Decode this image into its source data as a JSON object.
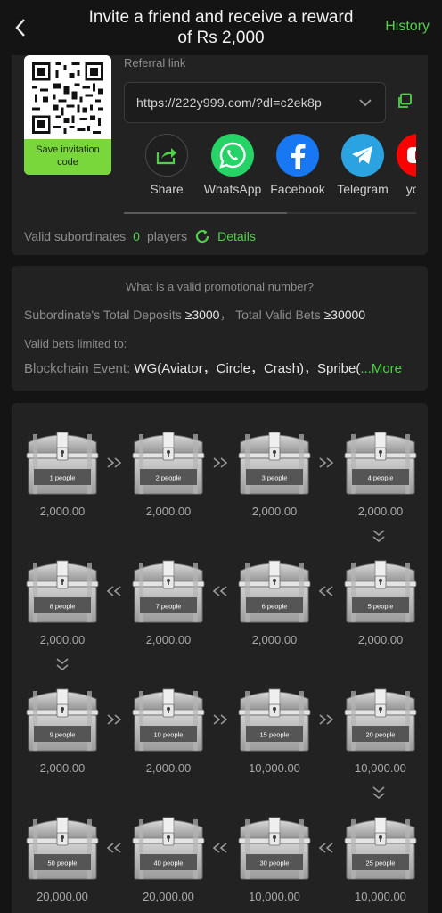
{
  "header": {
    "title": "Invite a friend and receive a reward of Rs 2,000",
    "history_label": "History"
  },
  "referral": {
    "qr_save_label": "Save invitation code",
    "link_label": "Referral link",
    "link_value": "https://222y999.com/?dl=c2ek8p"
  },
  "share": [
    {
      "label": "Share",
      "icon": "share-icon",
      "color": "#2a2a2a"
    },
    {
      "label": "WhatsApp",
      "icon": "whatsapp-icon",
      "color": "#25d366"
    },
    {
      "label": "Facebook",
      "icon": "facebook-icon",
      "color": "#1877f2"
    },
    {
      "label": "Telegram",
      "icon": "telegram-icon",
      "color": "#2aa3e0"
    },
    {
      "label": "yout",
      "icon": "youtube-icon",
      "color": "#ff0000"
    }
  ],
  "subordinates": {
    "label": "Valid subordinates",
    "count": "0",
    "unit": "players",
    "details_label": "Details"
  },
  "rules": {
    "title": "What is a valid promotional number?",
    "deposits_label": "Subordinate's Total Deposits",
    "deposits_value": "≥3000",
    "bets_label": "Total Valid Bets",
    "bets_value": "≥30000",
    "limited_label": "Valid bets limited to:",
    "event_label": "Blockchain Event:",
    "event_value": "WG(Aviator，Circle，Crash)，Spribe(",
    "more_label": "...More"
  },
  "chests": [
    {
      "people": "1 people",
      "amount": "2,000.00"
    },
    {
      "people": "2 people",
      "amount": "2,000.00"
    },
    {
      "people": "3 people",
      "amount": "2,000.00"
    },
    {
      "people": "4 people",
      "amount": "2,000.00"
    },
    {
      "people": "8 people",
      "amount": "2,000.00"
    },
    {
      "people": "7 people",
      "amount": "2,000.00"
    },
    {
      "people": "6 people",
      "amount": "2,000.00"
    },
    {
      "people": "5 people",
      "amount": "2,000.00"
    },
    {
      "people": "9 people",
      "amount": "2,000.00"
    },
    {
      "people": "10 people",
      "amount": "2,000.00"
    },
    {
      "people": "15 people",
      "amount": "10,000.00"
    },
    {
      "people": "20 people",
      "amount": "10,000.00"
    },
    {
      "people": "50 people",
      "amount": "20,000.00"
    },
    {
      "people": "40 people",
      "amount": "20,000.00"
    },
    {
      "people": "30 people",
      "amount": "10,000.00"
    },
    {
      "people": "25 people",
      "amount": "10,000.00"
    }
  ],
  "colors": {
    "accent": "#4fd14a",
    "qr_button": "#79d73c",
    "background": "#141414",
    "card": "#222222"
  }
}
